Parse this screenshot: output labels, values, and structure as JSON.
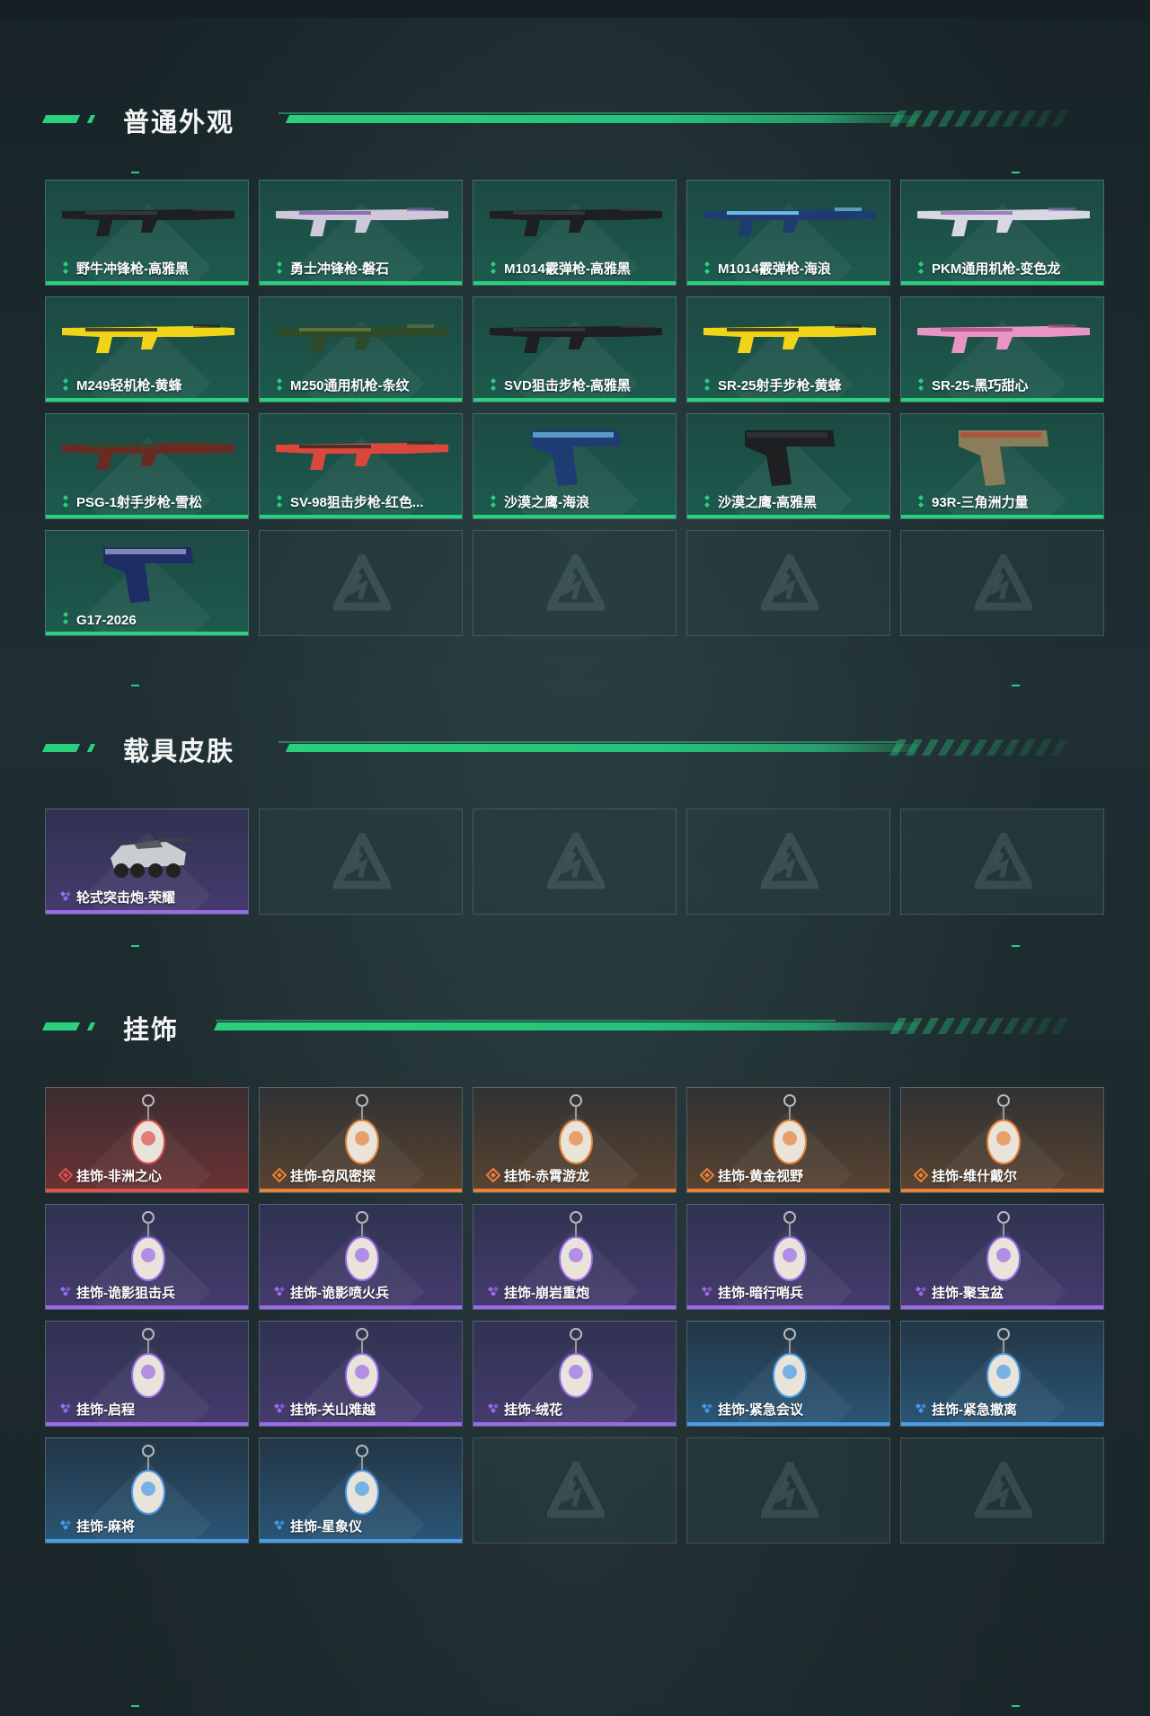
{
  "sections": [
    {
      "title": "普通外观",
      "items": [
        {
          "label": "野牛冲锋枪-高雅黑",
          "rarity": "green",
          "icon": "smg-black-icon"
        },
        {
          "label": "勇士冲锋枪-磐石",
          "rarity": "green",
          "icon": "smg-marble-icon"
        },
        {
          "label": "M1014霰弹枪-高雅黑",
          "rarity": "green",
          "icon": "shotgun-black-icon"
        },
        {
          "label": "M1014霰弹枪-海浪",
          "rarity": "green",
          "icon": "shotgun-wave-icon"
        },
        {
          "label": "PKM通用机枪-变色龙",
          "rarity": "green",
          "icon": "machine-gun-chameleon-icon"
        },
        {
          "label": "M249轻机枪-黄蜂",
          "rarity": "green",
          "icon": "lmg-hornet-icon"
        },
        {
          "label": "M250通用机枪-条纹",
          "rarity": "green",
          "icon": "machine-gun-stripe-icon"
        },
        {
          "label": "SVD狙击步枪-高雅黑",
          "rarity": "green",
          "icon": "sniper-black-icon"
        },
        {
          "label": "SR-25射手步枪-黄蜂",
          "rarity": "green",
          "icon": "marksman-rifle-hornet-icon"
        },
        {
          "label": "SR-25-黑巧甜心",
          "rarity": "green",
          "icon": "marksman-rifle-pink-icon"
        },
        {
          "label": "PSG-1射手步枪-雪松",
          "rarity": "green",
          "icon": "marksman-rifle-cedar-icon"
        },
        {
          "label": "SV-98狙击步枪-红色...",
          "rarity": "green",
          "icon": "sniper-red-icon"
        },
        {
          "label": "沙漠之鹰-海浪",
          "rarity": "green",
          "icon": "pistol-wave-icon"
        },
        {
          "label": "沙漠之鹰-高雅黑",
          "rarity": "green",
          "icon": "pistol-black-icon"
        },
        {
          "label": "93R-三角洲力量",
          "rarity": "green",
          "icon": "pistol-delta-icon"
        },
        {
          "label": "G17-2026",
          "rarity": "green",
          "icon": "pistol-navy-icon"
        }
      ]
    },
    {
      "title": "载具皮肤",
      "items": [
        {
          "label": "轮式突击炮-荣耀",
          "rarity": "purple",
          "icon": "armored-vehicle-icon"
        }
      ]
    },
    {
      "title": "挂饰",
      "items": [
        {
          "label": "挂饰-非洲之心",
          "rarity": "red",
          "icon": "charm-icon"
        },
        {
          "label": "挂饰-窃风密探",
          "rarity": "orange",
          "icon": "charm-icon"
        },
        {
          "label": "挂饰-赤霄游龙",
          "rarity": "orange",
          "icon": "charm-icon"
        },
        {
          "label": "挂饰-黄金视野",
          "rarity": "orange",
          "icon": "charm-icon"
        },
        {
          "label": "挂饰-维什戴尔",
          "rarity": "orange",
          "icon": "charm-icon"
        },
        {
          "label": "挂饰-诡影狙击兵",
          "rarity": "purple",
          "icon": "charm-icon"
        },
        {
          "label": "挂饰-诡影喷火兵",
          "rarity": "purple",
          "icon": "charm-icon"
        },
        {
          "label": "挂饰-崩岩重炮",
          "rarity": "purple",
          "icon": "charm-icon"
        },
        {
          "label": "挂饰-暗行哨兵",
          "rarity": "purple",
          "icon": "charm-icon"
        },
        {
          "label": "挂饰-聚宝盆",
          "rarity": "purple",
          "icon": "charm-icon"
        },
        {
          "label": "挂饰-启程",
          "rarity": "purple",
          "icon": "charm-icon"
        },
        {
          "label": "挂饰-关山难越",
          "rarity": "purple",
          "icon": "charm-icon"
        },
        {
          "label": "挂饰-绒花",
          "rarity": "purple",
          "icon": "charm-icon"
        },
        {
          "label": "挂饰-紧急会议",
          "rarity": "blue",
          "icon": "charm-icon"
        },
        {
          "label": "挂饰-紧急撤离",
          "rarity": "blue",
          "icon": "charm-icon"
        },
        {
          "label": "挂饰-麻将",
          "rarity": "blue",
          "icon": "charm-icon"
        },
        {
          "label": "挂饰-星象仪",
          "rarity": "blue",
          "icon": "charm-icon"
        }
      ]
    }
  ],
  "colors": {
    "accent": "#2ad07e",
    "green": "#2ad07e",
    "purple": "#9a6bea",
    "orange": "#e8823a",
    "red": "#e0504c",
    "blue": "#4a9be8"
  }
}
